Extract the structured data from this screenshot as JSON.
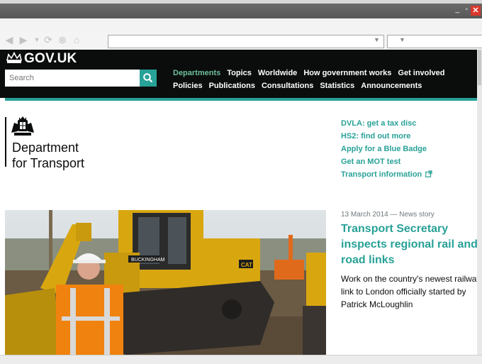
{
  "window": {
    "minimize": "_",
    "maximize": "▫",
    "close": "✕"
  },
  "browser": {
    "back_icon": "arrow-left-icon",
    "forward_icon": "arrow-right-icon",
    "address_value": "",
    "search_value": ""
  },
  "header": {
    "logo": "GOV.UK",
    "search_placeholder": "Search",
    "nav_row1": [
      "Departments",
      "Topics",
      "Worldwide",
      "How government works",
      "Get involved"
    ],
    "nav_row2": [
      "Policies",
      "Publications",
      "Consultations",
      "Statistics",
      "Announcements"
    ],
    "accent": "#28a197"
  },
  "department": {
    "name_line1": "Department",
    "name_line2": "for Transport"
  },
  "quick_links": [
    "DVLA: get a tax disc",
    "HS2: find out more",
    "Apply for a Blue Badge",
    "Get an MOT test",
    "Transport information"
  ],
  "news": {
    "meta": "13 March 2014 — News story",
    "title": "Transport Secretary inspects regional rail and road links",
    "description": "Work on the country's newest railway link to London officially started by Patrick McLoughlin"
  },
  "hero": {
    "cab_text": "BUCKINGHAM",
    "brand_text": "CAT"
  }
}
